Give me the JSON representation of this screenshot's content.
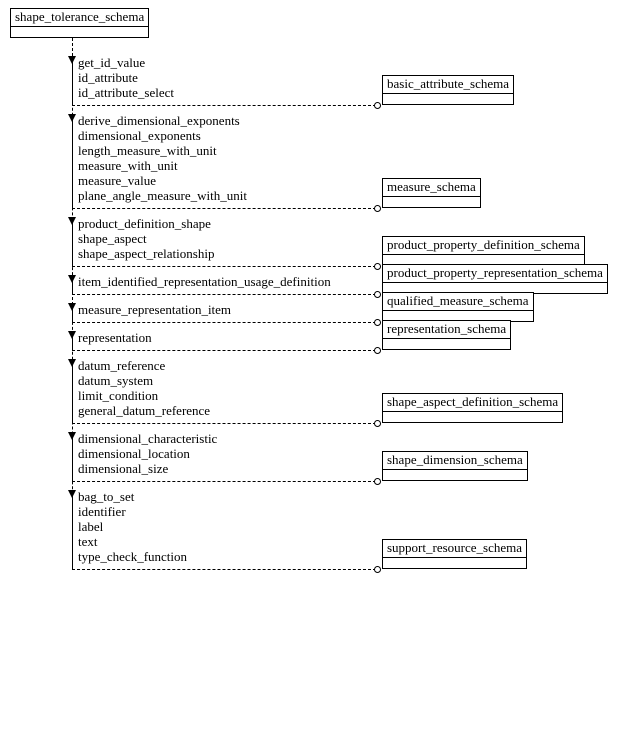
{
  "root": {
    "name": "shape_tolerance_schema"
  },
  "groups": [
    {
      "items": [
        "get_id_value",
        "id_attribute",
        "id_attribute_select"
      ],
      "target": "basic_attribute_schema"
    },
    {
      "items": [
        "derive_dimensional_exponents",
        "dimensional_exponents",
        "length_measure_with_unit",
        "measure_with_unit",
        "measure_value",
        "plane_angle_measure_with_unit"
      ],
      "target": "measure_schema"
    },
    {
      "items": [
        "product_definition_shape",
        "shape_aspect",
        "shape_aspect_relationship"
      ],
      "target": "product_property_definition_schema"
    },
    {
      "items": [
        "item_identified_representation_usage_definition"
      ],
      "target": "product_property_representation_schema"
    },
    {
      "items": [
        "measure_representation_item"
      ],
      "target": "qualified_measure_schema"
    },
    {
      "items": [
        "representation"
      ],
      "target": "representation_schema"
    },
    {
      "items": [
        "datum_reference",
        "datum_system",
        "limit_condition",
        "general_datum_reference"
      ],
      "target": "shape_aspect_definition_schema"
    },
    {
      "items": [
        "dimensional_characteristic",
        "dimensional_location",
        "dimensional_size"
      ],
      "target": "shape_dimension_schema"
    },
    {
      "items": [
        "bag_to_set",
        "identifier",
        "label",
        "text",
        "type_check_function"
      ],
      "target": "support_resource_schema"
    }
  ]
}
